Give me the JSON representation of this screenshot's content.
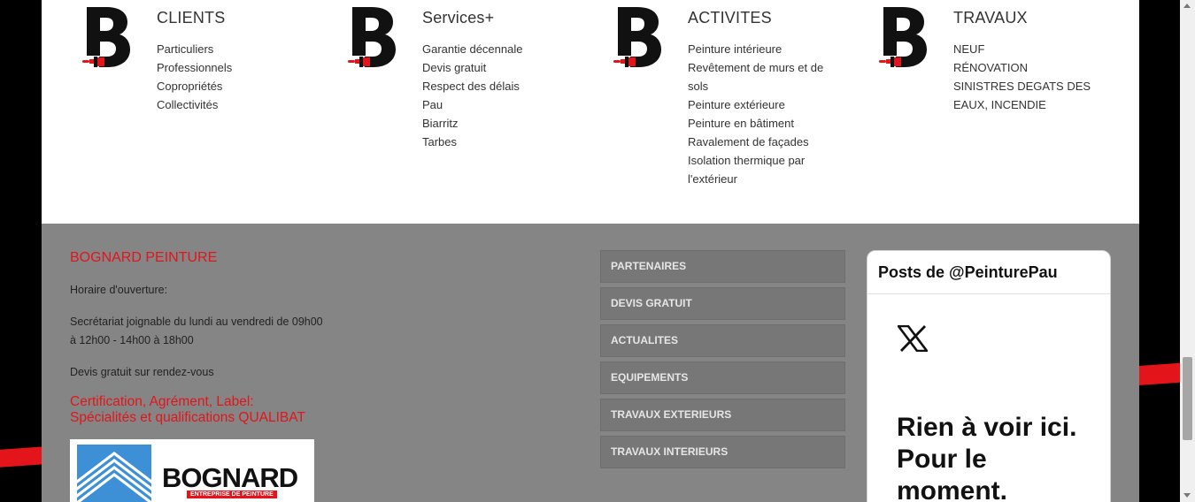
{
  "columns": [
    {
      "title": "CLIENTS",
      "items": [
        "Particuliers",
        "Professionnels",
        "Copropriétés",
        "Collectivités"
      ]
    },
    {
      "title": "Services+",
      "items": [
        "Garantie décennale",
        "Devis gratuit",
        "Respect des délais",
        "Pau",
        "Biarritz",
        "Tarbes"
      ]
    },
    {
      "title": "ACTIVITES",
      "items": [
        "Peinture intérieure",
        "Revêtement de murs et de sols",
        "Peinture extérieure",
        "Peinture en bâtiment",
        "Ravalement de façades",
        "Isolation thermique par l'extérieur"
      ]
    },
    {
      "title": "TRAVAUX",
      "items": [
        "NEUF",
        "RÉNOVATION",
        "SINISTRES DEGATS DES EAUX, INCENDIE"
      ]
    }
  ],
  "footer": {
    "company": "BOGNARD PEINTURE",
    "hours_label": "Horaire d'ouverture:",
    "secretariat": "Secrétariat joignable du lundi au vendredi de 09h00 à 12h00 - 14h00 à 18h00",
    "quote": "Devis gratuit sur rendez-vous",
    "cert_line1": "Certification, Agrément, Label:",
    "cert_line2": "Spécialités et qualifications QUALIBAT",
    "badge_name": "BOGNARD",
    "badge_sub": "ENTREPRISE DE PEINTURE",
    "nav": [
      "PARTENAIRES",
      "DEVIS GRATUIT",
      "ACTUALITES",
      "EQUIPEMENTS",
      "TRAVAUX EXTERIEURS",
      "TRAVAUX INTERIEURS"
    ]
  },
  "twitter": {
    "header": "Posts de @PeinturePau",
    "empty_message": "Rien à voir ici. Pour le moment."
  },
  "colors": {
    "accent_red": "#e3151a",
    "footer_bg": "#858585",
    "nav_bg": "#777777"
  },
  "icons": {
    "column_logo": "brush-b-logo-icon",
    "twitter": "x-logo-icon"
  }
}
